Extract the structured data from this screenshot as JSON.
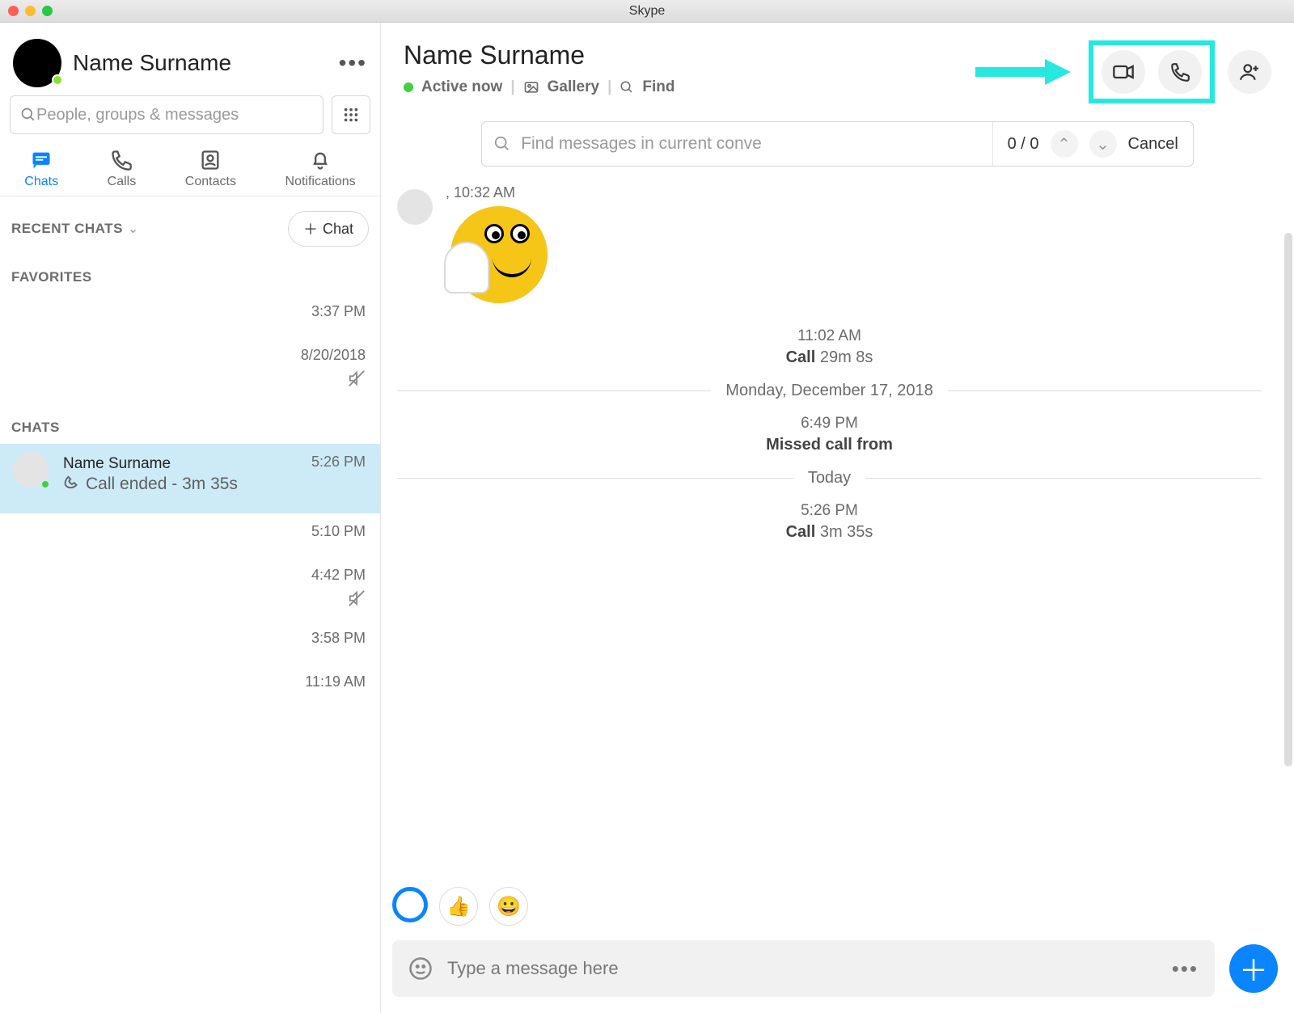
{
  "window": {
    "title": "Skype"
  },
  "sidebar": {
    "profile_name": "Name Surname",
    "search_placeholder": "People, groups & messages",
    "tabs": [
      {
        "label": "Chats"
      },
      {
        "label": "Calls"
      },
      {
        "label": "Contacts"
      },
      {
        "label": "Notifications"
      }
    ],
    "recent_label": "RECENT CHATS",
    "newchat_label": "Chat",
    "favorites_label": "FAVORITES",
    "chats_label": "CHATS",
    "items": [
      {
        "time": "3:37 PM"
      },
      {
        "time": "8/20/2018",
        "muted": true
      },
      {
        "name": "Name Surname",
        "sub": "Call ended - 3m 35s",
        "time": "5:26 PM",
        "selected": true
      },
      {
        "time": "5:10 PM"
      },
      {
        "time": "4:42 PM",
        "muted": true
      },
      {
        "time": "3:58 PM"
      },
      {
        "time": "11:19 AM"
      }
    ]
  },
  "conversation": {
    "title": "Name Surname",
    "status": "Active now",
    "gallery_label": "Gallery",
    "find_label": "Find",
    "findbar": {
      "placeholder": "Find messages in current conve",
      "counter": "0 / 0",
      "cancel": "Cancel"
    },
    "messages": {
      "first_ts": ", 10:32 AM",
      "call1_ts": "11:02 AM",
      "call1_label": "Call",
      "call1_dur": "29m 8s",
      "divider1": "Monday, December 17, 2018",
      "missed_ts": "6:49 PM",
      "missed_label": "Missed call from",
      "divider2": "Today",
      "call2_ts": "5:26 PM",
      "call2_label": "Call",
      "call2_dur": "3m 35s"
    },
    "composer_placeholder": "Type a message here"
  }
}
